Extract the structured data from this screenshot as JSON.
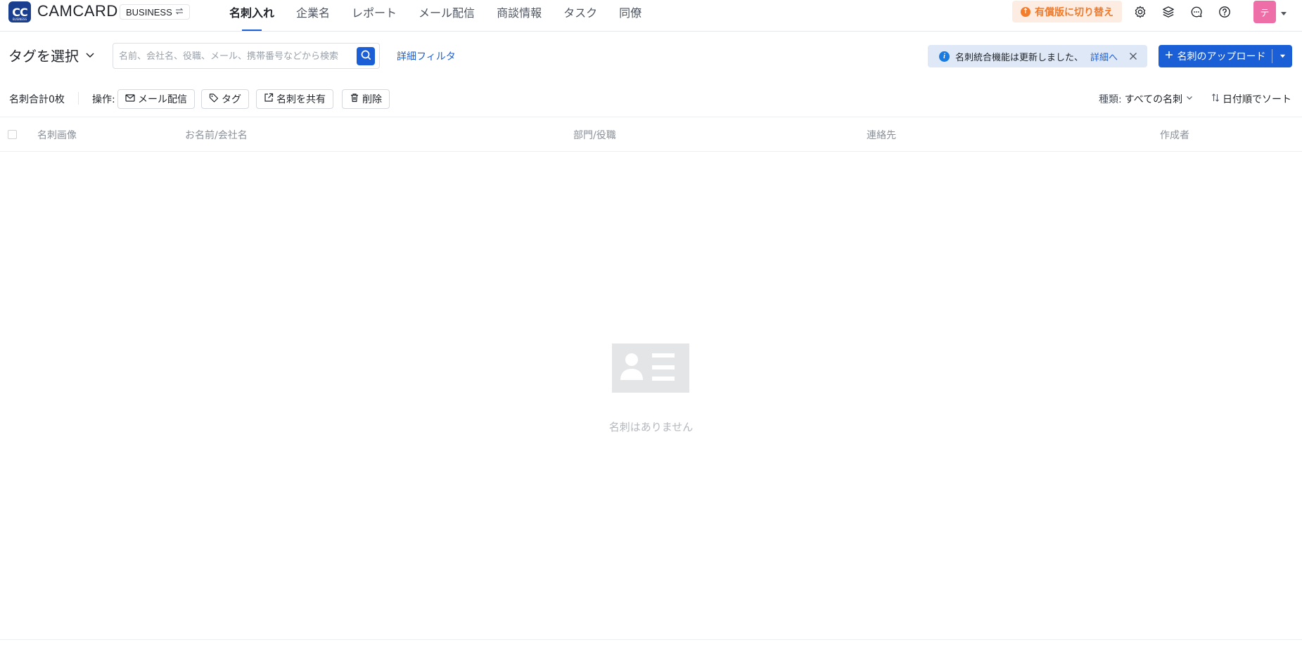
{
  "header": {
    "logo_text": "CC",
    "logo_sub": "BUSINESS",
    "brand": "CAMCARD",
    "plan_label": "BUSINESS",
    "plan_icon": "swap-icon",
    "tabs": [
      {
        "label": "名刺入れ",
        "active": true
      },
      {
        "label": "企業名"
      },
      {
        "label": "レポート"
      },
      {
        "label": "メール配信"
      },
      {
        "label": "商談情報"
      },
      {
        "label": "タスク"
      },
      {
        "label": "同僚"
      }
    ],
    "upgrade_label": "有償版に切り替え",
    "avatar_text": "テ",
    "icons": [
      "gear-icon",
      "layers-icon",
      "chat-icon",
      "help-icon"
    ]
  },
  "filter": {
    "tag_select_label": "タグを選択",
    "search_placeholder": "名前、会社名、役職、メール、携帯番号などから検索",
    "advanced_filter_label": "詳細フィルタ",
    "notice_text": "名刺統合機能は更新しました、",
    "notice_link": "詳細へ",
    "upload_label": "名刺のアップロード"
  },
  "actions": {
    "total_label": "名刺合計0枚",
    "operation_label": "操作:",
    "buttons": [
      {
        "label": "メール配信",
        "icon": "mail-icon"
      },
      {
        "label": "タグ",
        "icon": "tag-icon"
      },
      {
        "label": "名刺を共有",
        "icon": "share-icon"
      },
      {
        "label": "削除",
        "icon": "trash-icon"
      }
    ],
    "kind_label": "種類:",
    "kind_value": "すべての名刺",
    "sort_label": "日付順でソート"
  },
  "table": {
    "columns": [
      "名刺画像",
      "お名前/会社名",
      "部門/役職",
      "連絡先",
      "作成者"
    ]
  },
  "empty": {
    "text": "名刺はありません"
  },
  "colors": {
    "accent": "#1a5fd6",
    "upgrade_bg": "#fdece1",
    "upgrade_text": "#f07a2a",
    "avatar": "#ee6fa8",
    "notice_bg": "#dfe8f7"
  }
}
